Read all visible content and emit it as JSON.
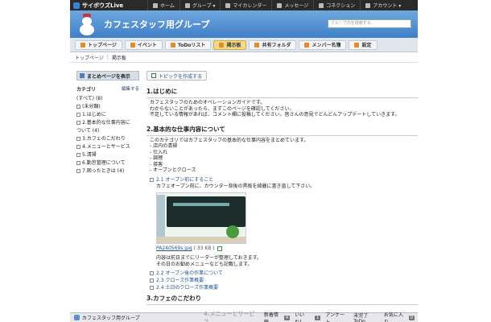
{
  "topbar": {
    "logo": "サイボウズLive",
    "nav": [
      {
        "label": "ホーム",
        "icon": "home-icon"
      },
      {
        "label": "グループ ▾",
        "icon": "group-icon"
      },
      {
        "label": "マイカレンダー",
        "icon": "calendar-icon"
      },
      {
        "label": "メッセージ",
        "icon": "message-icon"
      },
      {
        "label": "コネクション",
        "icon": "connection-icon"
      },
      {
        "label": "アカウント ▾",
        "icon": "account-icon"
      }
    ]
  },
  "header": {
    "group_title": "カフェスタッフ用グループ",
    "search_placeholder": "グループ内を検索する"
  },
  "tabs": [
    {
      "label": "トップページ",
      "active": false
    },
    {
      "label": "イベント",
      "active": false
    },
    {
      "label": "ToDoリスト",
      "active": false
    },
    {
      "label": "掲示板",
      "active": true
    },
    {
      "label": "共有フォルダ",
      "active": false
    },
    {
      "label": "メンバー名簿",
      "active": false
    },
    {
      "label": "設定",
      "active": false
    }
  ],
  "breadcrumb": {
    "top": "トップページ",
    "current": "掲示板"
  },
  "sidebar": {
    "summary_button": "まとめページを表示",
    "category_heading": "カテゴリ",
    "edit_link": "編集する",
    "categories": [
      {
        "label": "(すべて)",
        "count": "(8)",
        "toggle": false
      },
      {
        "label": "(未分類)",
        "count": "",
        "toggle": true
      },
      {
        "label": "1.はじめに",
        "count": "",
        "toggle": true
      },
      {
        "label": "2.基本的な仕事内容に",
        "count": "",
        "toggle": true
      },
      {
        "label": "ついて",
        "count": "(4)",
        "toggle": false
      },
      {
        "label": "3.カフェのこだわり",
        "count": "",
        "toggle": true
      },
      {
        "label": "4.メニューとサービス",
        "count": "",
        "toggle": true
      },
      {
        "label": "5.清掃",
        "count": "",
        "toggle": true
      },
      {
        "label": "6.勤怠管理について",
        "count": "",
        "toggle": true
      },
      {
        "label": "7.困ったときは",
        "count": "(4)",
        "toggle": true
      }
    ]
  },
  "main": {
    "create_topic": "トピックを作成する",
    "sections": [
      {
        "title": "1.はじめに",
        "lines": [
          "カフェスタッフのためのオペレーションガイドです。",
          "わからないことがあったら、まずこのページを確認してください。",
          "不足している情報があれば、コメント欄に投稿してください。皆さんの意見でどんどんアップデートしていきます。"
        ]
      },
      {
        "title": "2.基本的な仕事内容について",
        "lines": [
          "このカテゴリではカフェスタッフの基本的な仕事内容をまとめています。",
          "- 店内の清掃",
          "- 仕入れ",
          "- 調理",
          "- 接客",
          "- オープンとクローズ"
        ]
      }
    ],
    "sub_open": {
      "title": "2.1 オープン前にすること",
      "line": "カフェオープン前に、カウンター背後の黒板を綺麗に書き直して下さい。",
      "file_name": "PA240569s.jpg",
      "file_size": "( 33 KB )",
      "note_lines": [
        "内容は前日までにリーダーが整理しておきます。",
        "その日のお勧めメニューなども記載します。"
      ]
    },
    "sub_items": [
      "2.2 オープン後の作業について",
      "2.3 クローズ作業概要",
      "2.4 土日のクローズ作業概要"
    ],
    "section3_title": "3.カフェのこだわり"
  },
  "bottombar": {
    "group_name": "カフェスタッフ用グループ",
    "ghost_section": "4.メニューとサービス",
    "items": [
      {
        "label": "新着情報",
        "count": "4"
      },
      {
        "label": "いいね！",
        "count": "1"
      },
      {
        "label": "アンケート",
        "count": ""
      },
      {
        "label": "未完了ToDo",
        "count": ""
      },
      {
        "label": "お気に入り",
        "count": "0"
      }
    ]
  }
}
